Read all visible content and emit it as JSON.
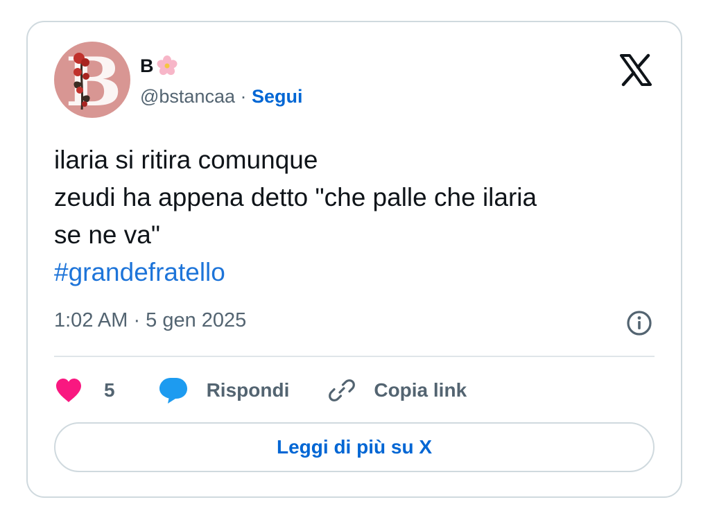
{
  "author": {
    "display_name": "B",
    "display_emoji": "cherry-blossom",
    "handle": "@bstancaa",
    "separator": " · ",
    "follow_label": "Segui",
    "avatar_letter": "B"
  },
  "tweet": {
    "lines": [
      "ilaria si ritira comunque",
      "zeudi ha appena detto \"che palle che ilaria",
      "se ne va\""
    ],
    "hashtag": "#grandefratello",
    "timestamp": "1:02 AM · 5 gen 2025"
  },
  "actions": {
    "like_count": "5",
    "reply_label": "Rispondi",
    "copy_link_label": "Copia link"
  },
  "read_more_label": "Leggi di più su X",
  "colors": {
    "link_blue": "#0066d4",
    "hashtag_blue": "#1d74d9",
    "heart_pink": "#f91880",
    "reply_blue": "#1d9bf0",
    "muted_text": "#536471",
    "border": "#cfd9de"
  },
  "icons": [
    "x-logo-icon",
    "info-icon",
    "heart-icon",
    "speech-bubble-icon",
    "link-icon",
    "cherry-blossom-icon"
  ]
}
